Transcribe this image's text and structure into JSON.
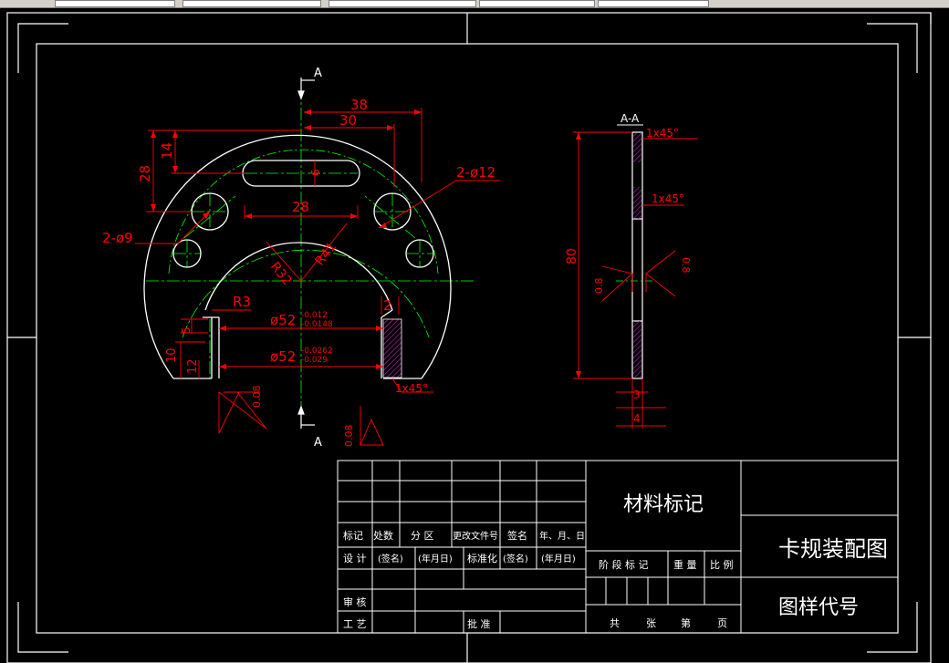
{
  "section": {
    "top_label": "A",
    "bottom_label": "A",
    "side_title": "A-A"
  },
  "front_view": {
    "dim_38": "38",
    "dim_30": "30",
    "dim_28_vert": "28",
    "dim_14": "14",
    "dim_6": "6",
    "dim_28_horiz": "28",
    "hole_large": "2-ø12",
    "hole_small": "2-ø9",
    "radius_inner": "R32",
    "radius_outer": "R41",
    "radius_corner": "R3",
    "gap": "2",
    "dim_5": "5",
    "dim_10": "10",
    "dim_12": "12",
    "tol1_base": "ø52",
    "tol1_upper": "-0.012",
    "tol1_lower": "-0.0148",
    "tol2_base": "ø52",
    "tol2_upper": "-0.0262",
    "tol2_lower": "-0.029",
    "chamfer": "1x45°",
    "rough_left": "0.08",
    "rough_bottom": "0.08"
  },
  "side_view": {
    "chamfer_top": "1x45°",
    "chamfer_mid": "1x45°",
    "height": "80",
    "rough_left": "0.8",
    "rough_right": "0.8",
    "thick_3": "3",
    "thick_4": "4"
  },
  "title_block": {
    "material_mark": "材料标记",
    "drawing_title": "卡规装配图",
    "drawing_code": "图样代号",
    "row_labels": {
      "mark": "标记",
      "count": "处数",
      "zone": "分 区",
      "change_doc": "更改文件号",
      "sign": "签名",
      "date": "年、月、日"
    },
    "design": "设 计",
    "sign_paren1": "(签名)",
    "date_paren1": "(年月日)",
    "standard": "标准化",
    "sign_paren2": "(签名)",
    "date_paren2": "(年月日)",
    "stage_mark": "阶 段 标 记",
    "weight": "重 量",
    "scale": "比 例",
    "review": "审 核",
    "process": "工 艺",
    "approve": "批 准",
    "total": "共",
    "sheets": "张",
    "nth": "第",
    "page": "页"
  },
  "colors": {
    "background": "#000000",
    "outline": "#ffffff",
    "dimension": "#ff0000",
    "centerline": "#00ff00",
    "hatch": "#a020a0"
  }
}
